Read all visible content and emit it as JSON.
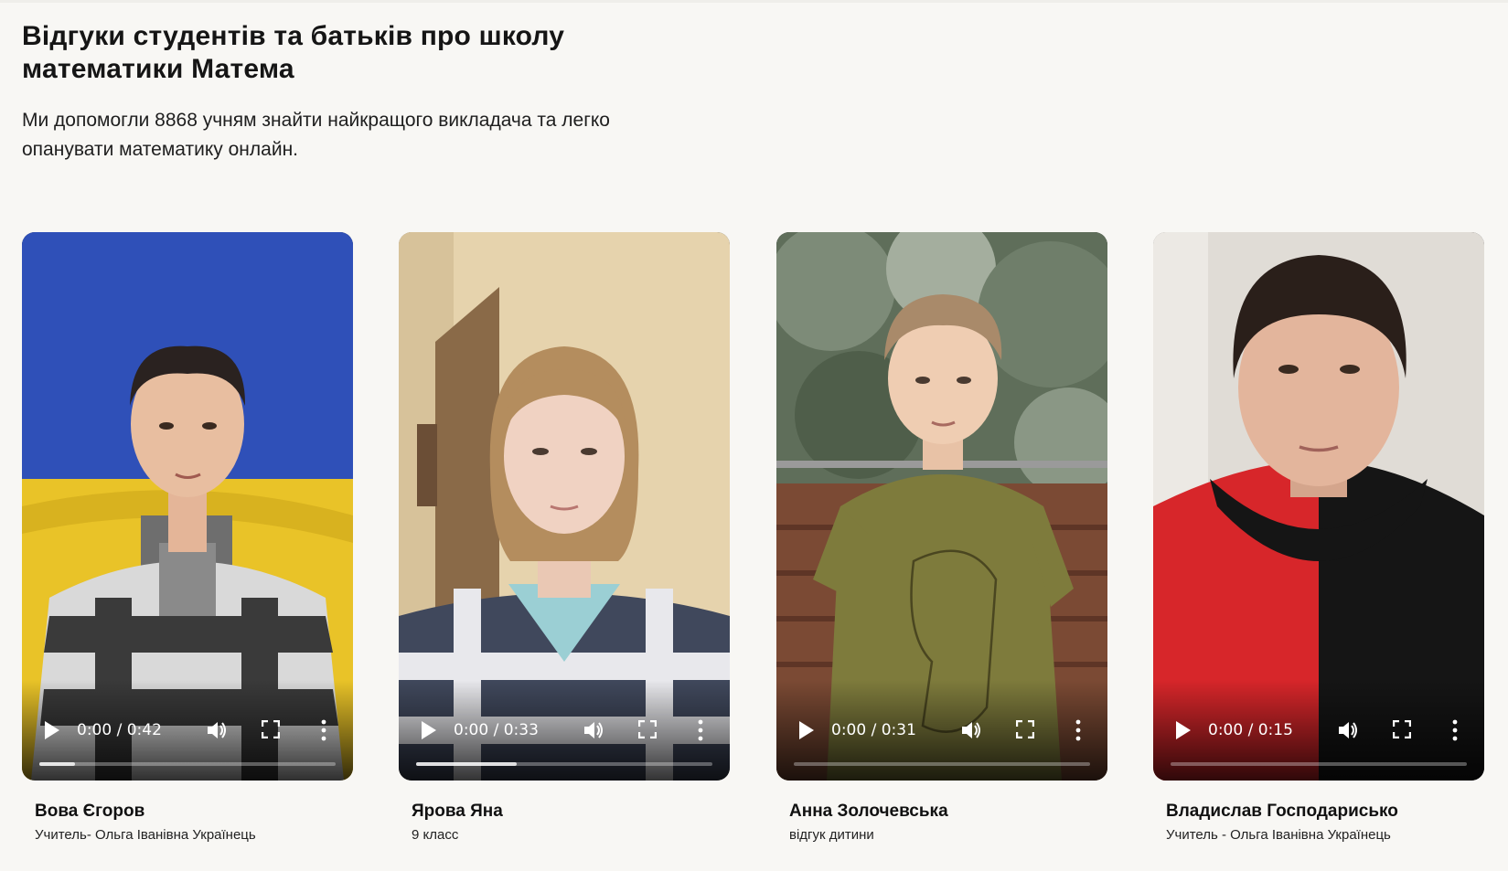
{
  "header": {
    "title": "Відгуки студентів та батьків про школу математики Матема",
    "subtitle": "Ми допомогли 8868 учням знайти найкращого викладача та легко опанувати математику онлайн."
  },
  "colors": {
    "background": "#f8f7f4",
    "text": "#151515"
  },
  "testimonials": [
    {
      "name": "Вова Єгоров",
      "role": "Учитель- Ольга Іванівна Українець",
      "time": "0:00 / 0:42",
      "progress": 0.12
    },
    {
      "name": "Ярова Яна",
      "role": "9 класс",
      "time": "0:00 / 0:33",
      "progress": 0.34
    },
    {
      "name": "Анна Золочевська",
      "role": "відгук дитини",
      "time": "0:00 / 0:31",
      "progress": 0.0
    },
    {
      "name": "Владислав Господарисько",
      "role": "Учитель - Ольга Іванівна Українець",
      "time": "0:00 / 0:15",
      "progress": 0.0
    }
  ],
  "icons": {
    "play": "play-icon",
    "volume": "volume-icon",
    "fullscreen": "fullscreen-icon",
    "more": "more-vertical-icon"
  }
}
